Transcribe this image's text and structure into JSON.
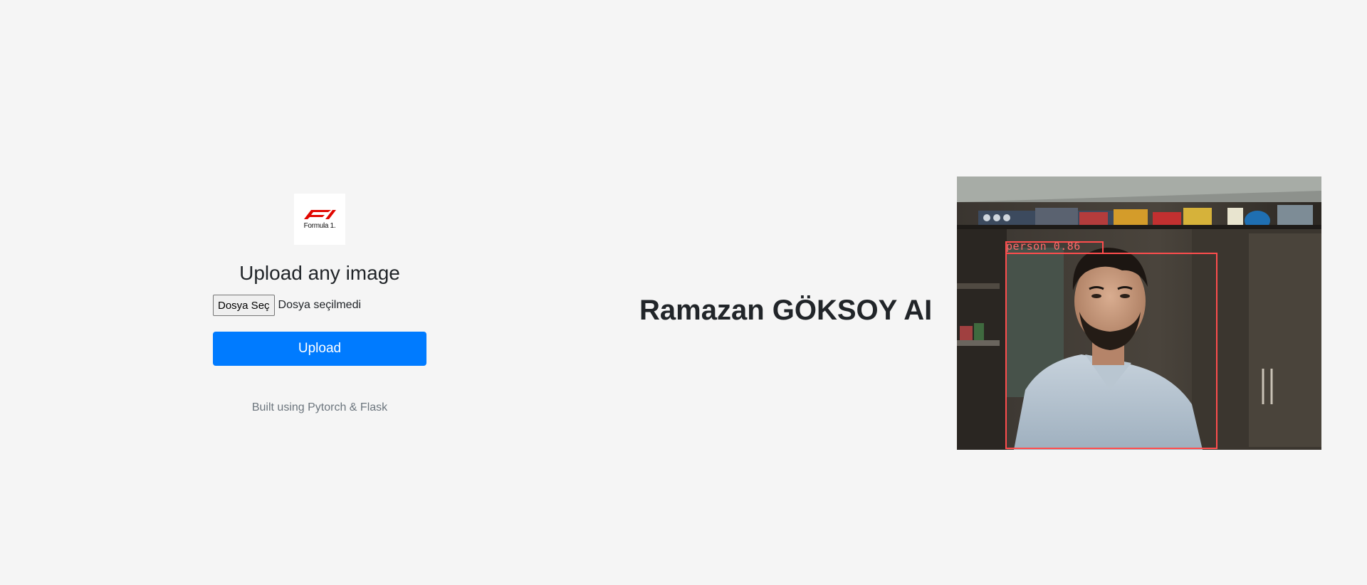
{
  "logo": {
    "text": "Formula 1.",
    "icon": "formula1-logo"
  },
  "upload": {
    "heading": "Upload any image",
    "file_button_label": "Dosya Seç",
    "file_status": "Dosya seçilmedi",
    "submit_label": "Upload",
    "footer": "Built using Pytorch & Flask"
  },
  "title": "Ramazan GÖKSOY AI",
  "result_image": {
    "detection_label": "person 0.86",
    "box_color": "#ff4d4d"
  },
  "colors": {
    "background": "#f5f5f5",
    "primary": "#007bff",
    "logo_red": "#e10600"
  }
}
